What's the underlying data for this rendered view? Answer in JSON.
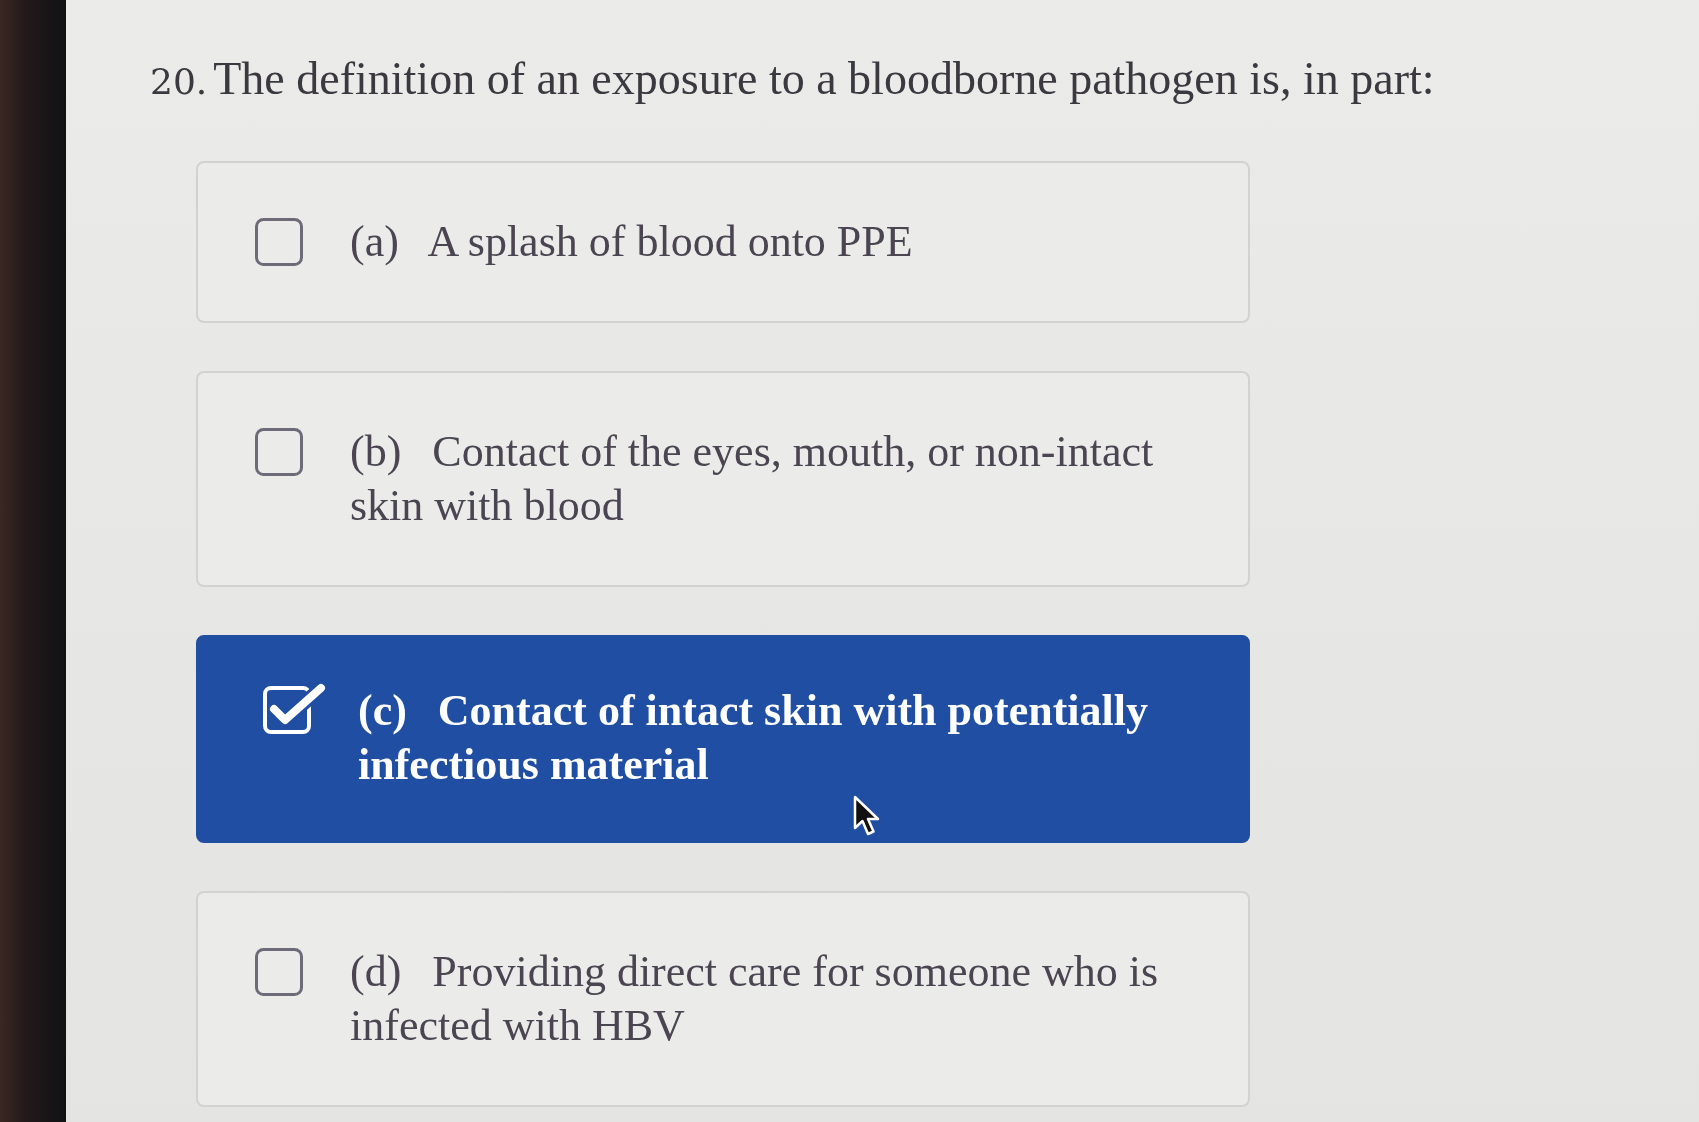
{
  "question": {
    "number": "20.",
    "text": "The definition of an exposure to a bloodborne pathogen is, in part:"
  },
  "options": [
    {
      "letter": "(a)",
      "text": "A splash of blood onto PPE",
      "selected": false
    },
    {
      "letter": "(b)",
      "text": "Contact of the eyes, mouth, or non-intact skin with blood",
      "selected": false
    },
    {
      "letter": "(c)",
      "text": "Contact of intact skin with potentially infectious material",
      "selected": true
    },
    {
      "letter": "(d)",
      "text": "Providing direct care for someone who is infected with HBV",
      "selected": false
    }
  ]
}
